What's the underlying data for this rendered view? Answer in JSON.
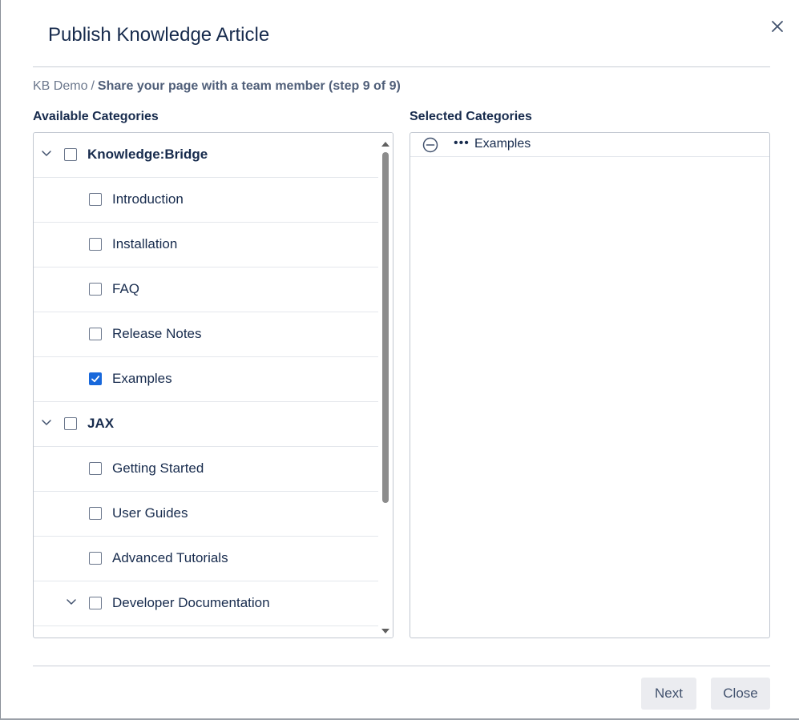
{
  "dialog": {
    "title": "Publish Knowledge Article",
    "close_icon": "close-icon"
  },
  "breadcrumb": {
    "root": "KB Demo",
    "separator": "/",
    "current": "Share your page with a team member (step 9 of 9)"
  },
  "available": {
    "title": "Available Categories",
    "items": [
      {
        "label": "Knowledge:Bridge",
        "level": 0,
        "bold": true,
        "expandable": true,
        "checked": false
      },
      {
        "label": "Introduction",
        "level": 1,
        "bold": false,
        "expandable": false,
        "checked": false
      },
      {
        "label": "Installation",
        "level": 1,
        "bold": false,
        "expandable": false,
        "checked": false
      },
      {
        "label": "FAQ",
        "level": 1,
        "bold": false,
        "expandable": false,
        "checked": false
      },
      {
        "label": "Release Notes",
        "level": 1,
        "bold": false,
        "expandable": false,
        "checked": false
      },
      {
        "label": "Examples",
        "level": 1,
        "bold": false,
        "expandable": false,
        "checked": true
      },
      {
        "label": "JAX",
        "level": 0,
        "bold": true,
        "expandable": true,
        "checked": false
      },
      {
        "label": "Getting Started",
        "level": 1,
        "bold": false,
        "expandable": false,
        "checked": false
      },
      {
        "label": "User Guides",
        "level": 1,
        "bold": false,
        "expandable": false,
        "checked": false
      },
      {
        "label": "Advanced Tutorials",
        "level": 1,
        "bold": false,
        "expandable": false,
        "checked": false
      },
      {
        "label": "Developer Documentation",
        "level": 1,
        "bold": false,
        "expandable": true,
        "checked": false
      }
    ]
  },
  "selected": {
    "title": "Selected Categories",
    "items": [
      {
        "prefix": "•••",
        "label": "Examples"
      }
    ]
  },
  "footer": {
    "next_label": "Next",
    "close_label": "Close"
  },
  "colors": {
    "accent": "#1868db",
    "text": "#172b4d",
    "button_bg": "#ebecf0"
  }
}
